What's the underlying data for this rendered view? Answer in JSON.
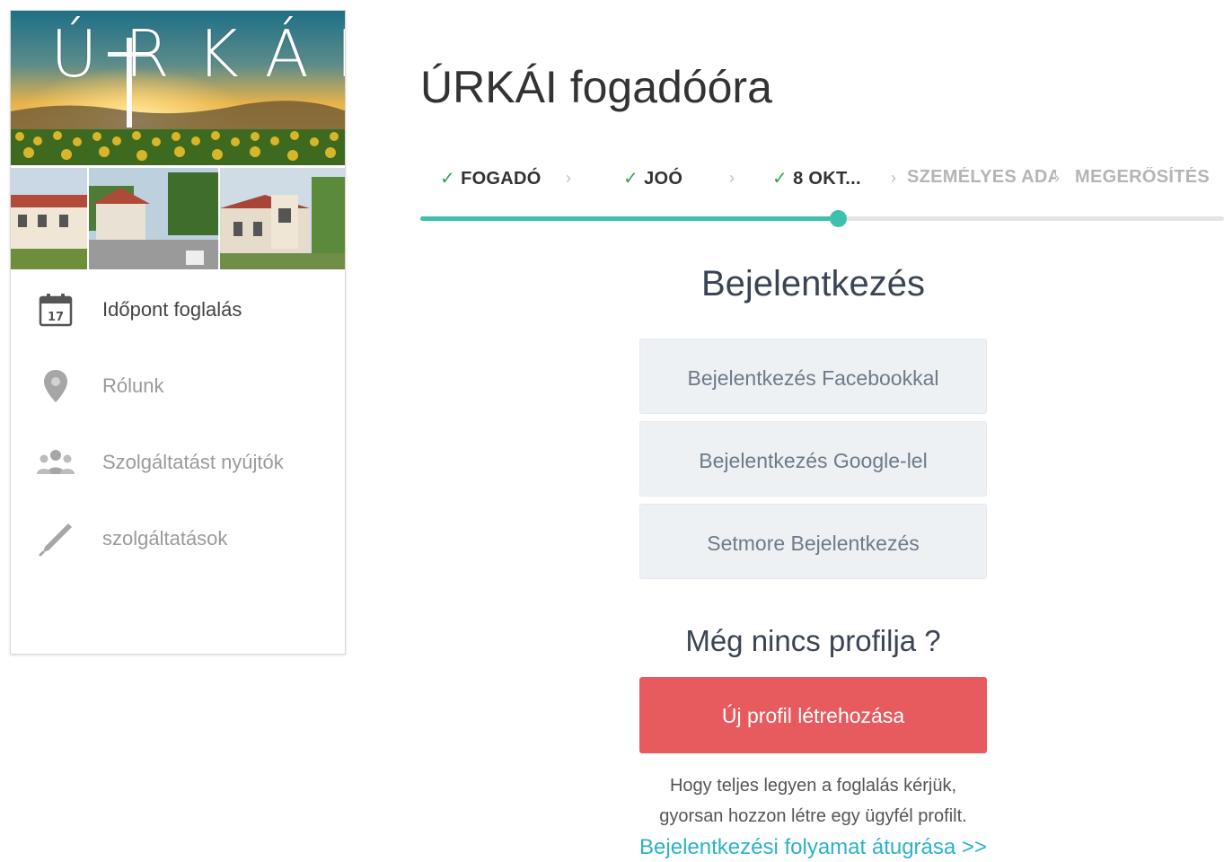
{
  "brand": {
    "name": "ÚRKÁI"
  },
  "sidebar": {
    "items": [
      {
        "label": "Időpont foglalás",
        "icon": "calendar-icon",
        "calendar_day": "17",
        "active": true
      },
      {
        "label": "Rólunk",
        "icon": "map-pin-icon",
        "active": false
      },
      {
        "label": "Szolgáltatást nyújtók",
        "icon": "users-icon",
        "active": false
      },
      {
        "label": "szolgáltatások",
        "icon": "pen-icon",
        "active": false
      }
    ]
  },
  "main": {
    "title": "ÚRKÁI fogadóóra",
    "steps": [
      {
        "label": "FOGADÓ",
        "done": true
      },
      {
        "label": "JOÓ",
        "done": true
      },
      {
        "label": "8 OKT...",
        "done": true
      },
      {
        "label": "SZEMÉLYES ADATOK",
        "done": false
      },
      {
        "label": "MEGERŐSÍTÉS",
        "done": false
      }
    ],
    "progress": 0.52,
    "check_glyph": "✓",
    "chevron_glyph": "›",
    "login": {
      "heading": "Bejelentkezés",
      "facebook_label": "Bejelentkezés Facebookkal",
      "google_label": "Bejelentkezés Google-lel",
      "setmore_label": "Setmore Bejelentkezés"
    },
    "signup": {
      "heading": "Még nincs profilja ?",
      "button_label": "Új profil létrehozása",
      "hint_line1": "Hogy teljes legyen a foglalás kérjük,",
      "hint_line2": "gyorsan hozzon létre egy ügyfél profilt.",
      "skip_link": "Bejelentkezési folyamat átugrása >>"
    }
  },
  "colors": {
    "accent": "#3ec1ac",
    "primary_button": "#e75a5d",
    "link": "#2bb2c9",
    "check": "#2fa84f",
    "secondary_button_bg": "#eef1f4"
  }
}
